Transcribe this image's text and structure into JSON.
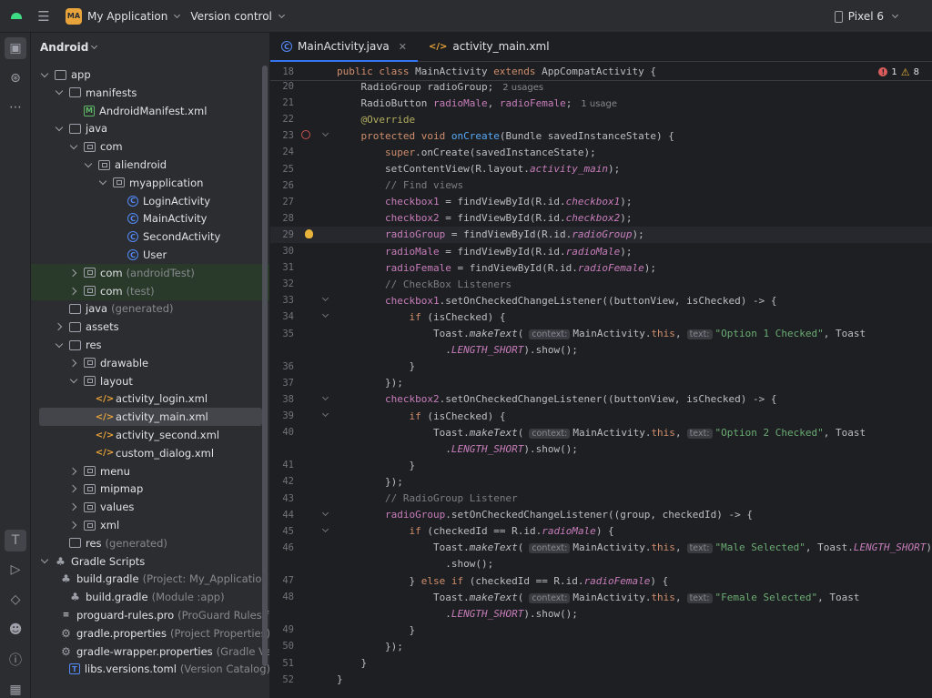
{
  "topbar": {
    "project_badge": "MA",
    "project_name": "My Application",
    "vcs": "Version control",
    "device": "Pixel 6"
  },
  "project_panel": {
    "title": "Android",
    "rows": [
      {
        "label": "app",
        "hint": "",
        "icon": "folder",
        "arrow": "down",
        "depth": 0
      },
      {
        "label": "manifests",
        "hint": "",
        "icon": "folder",
        "arrow": "down",
        "depth": 1
      },
      {
        "label": "AndroidManifest.xml",
        "hint": "",
        "icon": "manifest",
        "arrow": "none",
        "depth": 2
      },
      {
        "label": "java",
        "hint": "",
        "icon": "folder",
        "arrow": "down",
        "depth": 1
      },
      {
        "label": "com",
        "hint": "",
        "icon": "pkg",
        "arrow": "down",
        "depth": 2
      },
      {
        "label": "aliendroid",
        "hint": "",
        "icon": "pkg",
        "arrow": "down",
        "depth": 3
      },
      {
        "label": "myapplication",
        "hint": "",
        "icon": "pkg",
        "arrow": "down",
        "depth": 4
      },
      {
        "label": "LoginActivity",
        "hint": "",
        "icon": "cls",
        "arrow": "none",
        "depth": 5
      },
      {
        "label": "MainActivity",
        "hint": "",
        "icon": "cls",
        "arrow": "none",
        "depth": 5
      },
      {
        "label": "SecondActivity",
        "hint": "",
        "icon": "cls",
        "arrow": "none",
        "depth": 5
      },
      {
        "label": "User",
        "hint": "",
        "icon": "cls",
        "arrow": "none",
        "depth": 5
      },
      {
        "label": "com",
        "hint": "(androidTest)",
        "icon": "pkg",
        "arrow": "right",
        "depth": 2,
        "green": true
      },
      {
        "label": "com",
        "hint": "(test)",
        "icon": "pkg",
        "arrow": "right",
        "depth": 2,
        "green": true
      },
      {
        "label": "java",
        "hint": "(generated)",
        "icon": "folder",
        "arrow": "none",
        "depth": 1
      },
      {
        "label": "assets",
        "hint": "",
        "icon": "folder",
        "arrow": "right",
        "depth": 1
      },
      {
        "label": "res",
        "hint": "",
        "icon": "folder",
        "arrow": "down",
        "depth": 1
      },
      {
        "label": "drawable",
        "hint": "",
        "icon": "pkg",
        "arrow": "right",
        "depth": 2
      },
      {
        "label": "layout",
        "hint": "",
        "icon": "pkg",
        "arrow": "down",
        "depth": 2
      },
      {
        "label": "activity_login.xml",
        "hint": "",
        "icon": "xml",
        "arrow": "none",
        "depth": 3
      },
      {
        "label": "activity_main.xml",
        "hint": "",
        "icon": "xml",
        "arrow": "none",
        "depth": 3,
        "selected": true
      },
      {
        "label": "activity_second.xml",
        "hint": "",
        "icon": "xml",
        "arrow": "none",
        "depth": 3
      },
      {
        "label": "custom_dialog.xml",
        "hint": "",
        "icon": "xml",
        "arrow": "none",
        "depth": 3
      },
      {
        "label": "menu",
        "hint": "",
        "icon": "pkg",
        "arrow": "right",
        "depth": 2
      },
      {
        "label": "mipmap",
        "hint": "",
        "icon": "pkg",
        "arrow": "right",
        "depth": 2
      },
      {
        "label": "values",
        "hint": "",
        "icon": "pkg",
        "arrow": "right",
        "depth": 2
      },
      {
        "label": "xml",
        "hint": "",
        "icon": "pkg",
        "arrow": "right",
        "depth": 2
      },
      {
        "label": "res",
        "hint": "(generated)",
        "icon": "folder",
        "arrow": "none",
        "depth": 1
      },
      {
        "label": "Gradle Scripts",
        "hint": "",
        "icon": "gradle",
        "arrow": "down",
        "depth": 0
      },
      {
        "label": "build.gradle",
        "hint": "(Project: My_Application)",
        "icon": "gradle",
        "arrow": "none",
        "depth": 1
      },
      {
        "label": "build.gradle",
        "hint": "(Module :app)",
        "icon": "gradle",
        "arrow": "none",
        "depth": 1
      },
      {
        "label": "proguard-rules.pro",
        "hint": "(ProGuard Rules for",
        "icon": "file",
        "arrow": "none",
        "depth": 1
      },
      {
        "label": "gradle.properties",
        "hint": "(Project Properties)",
        "icon": "gear",
        "arrow": "none",
        "depth": 1
      },
      {
        "label": "gradle-wrapper.properties",
        "hint": "(Gradle Vers",
        "icon": "gear",
        "arrow": "none",
        "depth": 1
      },
      {
        "label": "libs.versions.toml",
        "hint": "(Version Catalog)",
        "icon": "toml",
        "arrow": "none",
        "depth": 1
      }
    ]
  },
  "tabs": [
    {
      "label": "MainActivity.java",
      "active": true
    },
    {
      "label": "activity_main.xml",
      "active": false
    }
  ],
  "inspections": {
    "errors": "1",
    "warnings": "8"
  },
  "sticky": {
    "line": "18",
    "text": "public class MainActivity extends AppCompatActivity {"
  },
  "code_lines": [
    {
      "n": "20",
      "html": "    <span class='code'>RadioGroup radioGroup;</span><span class='usage'>2 usages</span>"
    },
    {
      "n": "21",
      "html": "    <span class='code'>RadioButton </span><span class='fld'>radioMale</span><span class='code'>, </span><span class='fld'>radioFemale</span><span class='code'>;</span><span class='usage'>1 usage</span>"
    },
    {
      "n": "22",
      "html": "    <span class='an'>@Override</span>"
    },
    {
      "n": "23",
      "html": "    <span class='kw'>protected void </span><span class='fn'>onCreate</span><span class='code'>(Bundle savedInstanceState) {</span>",
      "override": true,
      "fold": true
    },
    {
      "n": "24",
      "html": "        <span class='kw'>super</span><span class='code'>.onCreate(savedInstanceState);</span>"
    },
    {
      "n": "25",
      "html": "        <span class='code'>setContentView(R.layout.</span><span class='fld-i'>activity_main</span><span class='code'>);</span>"
    },
    {
      "n": "26",
      "html": "        <span class='cm'>// Find views</span>"
    },
    {
      "n": "27",
      "html": "        <span class='fld'>checkbox1</span><span class='code'> = findViewById(R.id.</span><span class='fld-i'>checkbox1</span><span class='code'>);</span>"
    },
    {
      "n": "28",
      "html": "        <span class='fld'>checkbox2</span><span class='code'> = findViewById(R.id.</span><span class='fld-i'>checkbox2</span><span class='code'>);</span>"
    },
    {
      "n": "29",
      "html": "        <span class='fld'>radioGroup</span><span class='code'> = findViewById(R.id.</span><span class='fld-i'>radioGroup</span><span class='code'>);</span>",
      "current": true,
      "bulb": true
    },
    {
      "n": "30",
      "html": "        <span class='fld'>radioMale</span><span class='code'> = findViewById(R.id.</span><span class='fld-i'>radioMale</span><span class='code'>);</span>"
    },
    {
      "n": "31",
      "html": "        <span class='fld'>radioFemale</span><span class='code'> = findViewById(R.id.</span><span class='fld-i'>radioFemale</span><span class='code'>);</span>"
    },
    {
      "n": "32",
      "html": "        <span class='cm'>// CheckBox Listeners</span>"
    },
    {
      "n": "33",
      "html": "        <span class='fld'>checkbox1</span><span class='code'>.setOnCheckedChangeListener((buttonView, isChecked) -&gt; {</span>",
      "fold": true
    },
    {
      "n": "34",
      "html": "            <span class='kw'>if </span><span class='code'>(isChecked) {</span>",
      "fold": true
    },
    {
      "n": "35",
      "html": "                <span class='code'>Toast.</span><span class='mi code'>makeText</span><span class='code'>(</span><span class='inlay'>context:</span><span class='code'>MainActivity.</span><span class='kw'>this</span><span class='code'>,</span><span class='inlay'>text:</span><span class='st'>\"Option 1 Checked\"</span><span class='code'>, Toast</span>"
    },
    {
      "n": "",
      "html": "                  <span class='code'>.</span><span class='fld-i'>LENGTH_SHORT</span><span class='code'>).show();</span>"
    },
    {
      "n": "36",
      "html": "            <span class='code'>}</span>"
    },
    {
      "n": "37",
      "html": "        <span class='code'>});</span>"
    },
    {
      "n": "38",
      "html": "        <span class='fld'>checkbox2</span><span class='code'>.setOnCheckedChangeListener((buttonView, isChecked) -&gt; {</span>",
      "fold": true
    },
    {
      "n": "39",
      "html": "            <span class='kw'>if </span><span class='code'>(isChecked) {</span>",
      "fold": true
    },
    {
      "n": "40",
      "html": "                <span class='code'>Toast.</span><span class='mi code'>makeText</span><span class='code'>(</span><span class='inlay'>context:</span><span class='code'>MainActivity.</span><span class='kw'>this</span><span class='code'>,</span><span class='inlay'>text:</span><span class='st'>\"Option 2 Checked\"</span><span class='code'>, Toast</span>"
    },
    {
      "n": "",
      "html": "                  <span class='code'>.</span><span class='fld-i'>LENGTH_SHORT</span><span class='code'>).show();</span>"
    },
    {
      "n": "41",
      "html": "            <span class='code'>}</span>"
    },
    {
      "n": "42",
      "html": "        <span class='code'>});</span>"
    },
    {
      "n": "43",
      "html": "        <span class='cm'>// RadioGroup Listener</span>"
    },
    {
      "n": "44",
      "html": "        <span class='fld'>radioGroup</span><span class='code'>.setOnCheckedChangeListener((group, checkedId) -&gt; {</span>",
      "fold": true
    },
    {
      "n": "45",
      "html": "            <span class='kw'>if </span><span class='code'>(checkedId == R.id.</span><span class='fld-i'>radioMale</span><span class='code'>) {</span>",
      "fold": true
    },
    {
      "n": "46",
      "html": "                <span class='code'>Toast.</span><span class='mi code'>makeText</span><span class='code'>(</span><span class='inlay'>context:</span><span class='code'>MainActivity.</span><span class='kw'>this</span><span class='code'>,</span><span class='inlay'>text:</span><span class='st'>\"Male Selected\"</span><span class='code'>, Toast.</span><span class='fld-i'>LENGTH_SHORT</span><span class='code'>)</span>"
    },
    {
      "n": "",
      "html": "                  <span class='code'>.show();</span>"
    },
    {
      "n": "47",
      "html": "            <span class='code'>} </span><span class='kw'>else if </span><span class='code'>(checkedId == R.id.</span><span class='fld-i'>radioFemale</span><span class='code'>) {</span>"
    },
    {
      "n": "48",
      "html": "                <span class='code'>Toast.</span><span class='mi code'>makeText</span><span class='code'>(</span><span class='inlay'>context:</span><span class='code'>MainActivity.</span><span class='kw'>this</span><span class='code'>,</span><span class='inlay'>text:</span><span class='st'>\"Female Selected\"</span><span class='code'>, Toast</span>"
    },
    {
      "n": "",
      "html": "                  <span class='code'>.</span><span class='fld-i'>LENGTH_SHORT</span><span class='code'>).show();</span>"
    },
    {
      "n": "49",
      "html": "            <span class='code'>}</span>"
    },
    {
      "n": "50",
      "html": "        <span class='code'>});</span>"
    },
    {
      "n": "51",
      "html": "    <span class='code'>}</span>"
    },
    {
      "n": "52",
      "html": "<span class='code'>}</span>"
    }
  ]
}
